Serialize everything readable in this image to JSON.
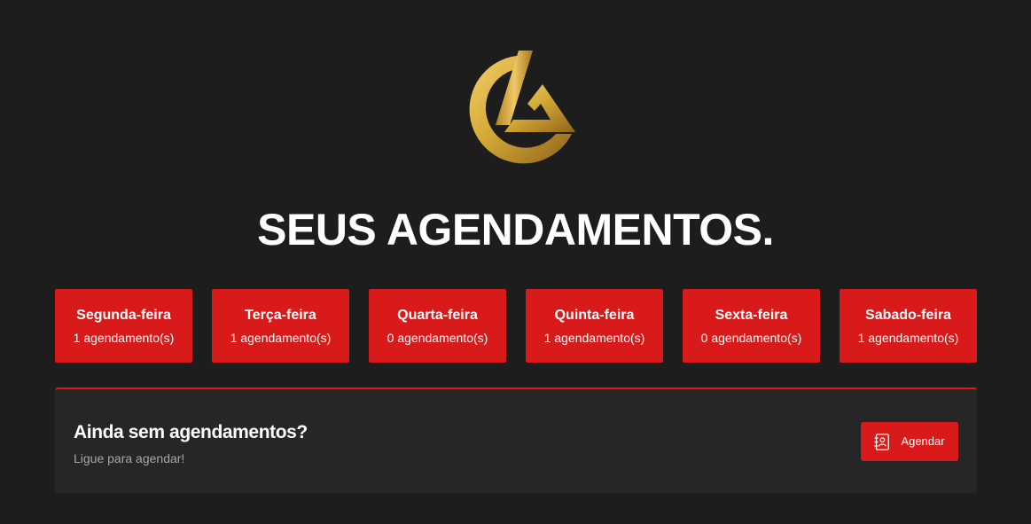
{
  "header": {
    "logo": "gold-circle-la-logo",
    "title": "SEUS AGENDAMENTOS."
  },
  "days": [
    {
      "name": "Segunda-feira",
      "count": "1 agendamento(s)"
    },
    {
      "name": "Terça-feira",
      "count": "1 agendamento(s)"
    },
    {
      "name": "Quarta-feira",
      "count": "0 agendamento(s)"
    },
    {
      "name": "Quinta-feira",
      "count": "1 agendamento(s)"
    },
    {
      "name": "Sexta-feira",
      "count": "0 agendamento(s)"
    },
    {
      "name": "Sabado-feira",
      "count": "1 agendamento(s)"
    }
  ],
  "cta": {
    "title": "Ainda sem agendamentos?",
    "subtitle": "Ligue para agendar!",
    "button_label": "Agendar",
    "button_icon": "contact-book-icon"
  },
  "colors": {
    "background": "#1d1d1d",
    "panel": "#262626",
    "accent": "#d91a1a",
    "gold": "#d4a937"
  }
}
